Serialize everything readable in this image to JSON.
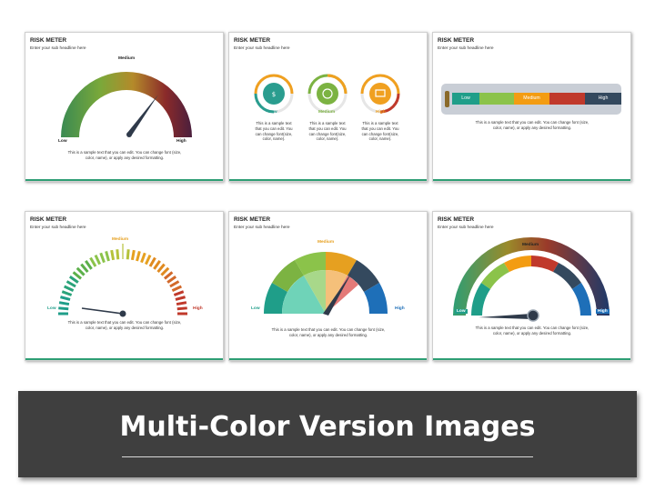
{
  "slides": [
    {
      "title": "RISK METER",
      "subtitle": "Enter your sub headline here",
      "labels": {
        "low": "Low",
        "medium": "Medium",
        "high": "High"
      },
      "description": "This is a sample text that you can edit. You can change font (size, color, name), or apply any desired formatting.",
      "gauge_colors": [
        "#3a8a52",
        "#7aa83a",
        "#c28a2c",
        "#8a2a2a",
        "#4a1f3d"
      ],
      "needle_color": "#2f3a4a"
    },
    {
      "title": "RISK METER",
      "subtitle": "Enter your sub headline here",
      "gauges": [
        {
          "label": "Low",
          "color": "#2a9d8f",
          "icon": "usd-icon"
        },
        {
          "label": "Medium",
          "color": "#7cb342",
          "icon": "piggy-bank-icon"
        },
        {
          "label": "High",
          "color": "#f0a020",
          "icon": "money-stack-icon"
        }
      ],
      "caption": "This is a sample text that you can edit. You can change font(size, color, name)."
    },
    {
      "title": "RISK METER",
      "subtitle": "Enter your sub headline here",
      "segments": [
        {
          "label": "Low",
          "color": "#1f9e89"
        },
        {
          "label": "",
          "color": "#8bc34a"
        },
        {
          "label": "Medium",
          "color": "#f39c12"
        },
        {
          "label": "",
          "color": "#c0392b"
        },
        {
          "label": "High",
          "color": "#34495e"
        }
      ],
      "description": "This is a sample text that you can edit. You can change font (size, color, name), or apply any desired formatting."
    },
    {
      "title": "RISK METER",
      "subtitle": "Enter your sub headline here",
      "labels": {
        "low": "Low",
        "medium": "Medium",
        "high": "High"
      },
      "label_colors": {
        "low": "#1f9e89",
        "medium": "#e6a020",
        "high": "#c0392b"
      },
      "description": "This is a sample text that you can edit. You can change font (size, color, name), or apply any desired formatting."
    },
    {
      "title": "RISK METER",
      "subtitle": "Enter your sub headline here",
      "labels": {
        "low": "Low",
        "medium": "Medium",
        "high": "High"
      },
      "label_colors": {
        "low": "#1f9e89",
        "medium": "#e6a020",
        "high": "#1e6fb8"
      },
      "description": "This is a sample text that you can edit. You can change font (size, color, name), or apply any desired formatting."
    },
    {
      "title": "RISK METER",
      "subtitle": "Enter your sub headline here",
      "labels": {
        "low": "Low",
        "medium": "Medium",
        "high": "High"
      },
      "description": "This is a sample text that you can edit. You can change font (size, color, name), or apply any desired formatting."
    }
  ],
  "banner": {
    "title": "Multi-Color Version Images"
  }
}
